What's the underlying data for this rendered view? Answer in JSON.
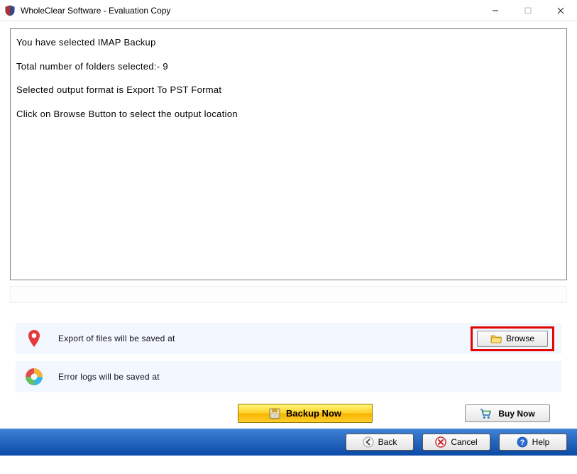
{
  "window": {
    "title": "WholeClear Software - Evaluation Copy"
  },
  "info": {
    "line1": "You have selected IMAP Backup",
    "line2": "Total number of folders selected:- 9",
    "line3": "Selected output format is Export To PST Format",
    "line4": "Click on Browse Button to select the output location"
  },
  "locations": {
    "export_label": "Export of files will be saved at",
    "errlog_label": "Error logs will be saved at",
    "browse_label": "Browse"
  },
  "actions": {
    "backup_label": "Backup Now",
    "buy_label": "Buy Now"
  },
  "footer": {
    "back_label": "Back",
    "cancel_label": "Cancel",
    "help_label": "Help"
  }
}
